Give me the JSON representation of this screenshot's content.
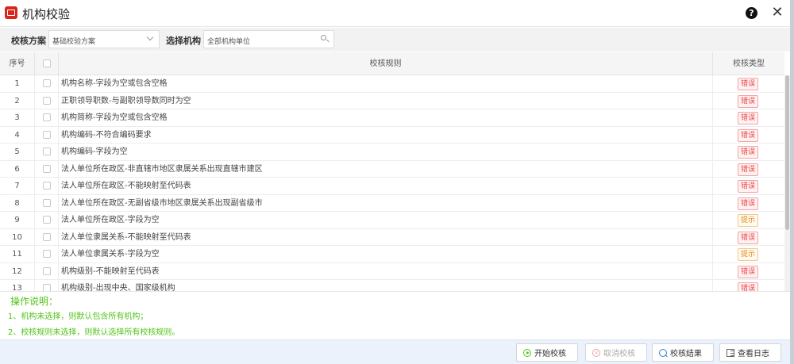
{
  "window": {
    "title": "机构校验"
  },
  "filters": {
    "scheme_label": "校核方案",
    "scheme_value": "基础校验方案",
    "org_label": "选择机构",
    "org_placeholder": "全部机构单位"
  },
  "table": {
    "headers": {
      "index": "序号",
      "rule": "校核规则",
      "type": "校核类型"
    },
    "rows": [
      {
        "idx": "1",
        "rule": "机构名称-字段为空或包含空格",
        "type": "错误",
        "kind": "error"
      },
      {
        "idx": "2",
        "rule": "正职领导职数-与副职领导数同时为空",
        "type": "错误",
        "kind": "error"
      },
      {
        "idx": "3",
        "rule": "机构简称-字段为空或包含空格",
        "type": "错误",
        "kind": "error"
      },
      {
        "idx": "4",
        "rule": "机构编码-不符合编码要求",
        "type": "错误",
        "kind": "error"
      },
      {
        "idx": "5",
        "rule": "机构编码-字段为空",
        "type": "错误",
        "kind": "error"
      },
      {
        "idx": "6",
        "rule": "法人单位所在政区-非直辖市地区隶属关系出现直辖市建区",
        "type": "错误",
        "kind": "error"
      },
      {
        "idx": "7",
        "rule": "法人单位所在政区-不能映射至代码表",
        "type": "错误",
        "kind": "error"
      },
      {
        "idx": "8",
        "rule": "法人单位所在政区-无副省级市地区隶属关系出现副省级市",
        "type": "错误",
        "kind": "error"
      },
      {
        "idx": "9",
        "rule": "法人单位所在政区-字段为空",
        "type": "提示",
        "kind": "hint"
      },
      {
        "idx": "10",
        "rule": "法人单位隶属关系-不能映射至代码表",
        "type": "错误",
        "kind": "error"
      },
      {
        "idx": "11",
        "rule": "法人单位隶属关系-字段为空",
        "type": "提示",
        "kind": "hint"
      },
      {
        "idx": "12",
        "rule": "机构级别-不能映射至代码表",
        "type": "错误",
        "kind": "error"
      },
      {
        "idx": "13",
        "rule": "机构级别-出现中央、国家级机构",
        "type": "错误",
        "kind": "error"
      }
    ]
  },
  "notes": {
    "title": "操作说明：",
    "line1": "1、机构未选择，则默认包含所有机构；",
    "line2": "2、校核规则未选择，则默认选择所有校核规则。"
  },
  "footer": {
    "start": "开始校核",
    "cancel": "取消校核",
    "result": "校核结果",
    "log": "查看日志"
  },
  "colors": {
    "error": "#e8454a",
    "error_border": "#f5a3a3",
    "error_bg": "#fff1f0",
    "hint": "#e08a1e",
    "hint_border": "#f4c888",
    "hint_bg": "#fffaf0",
    "notes_green": "#52c41a"
  }
}
